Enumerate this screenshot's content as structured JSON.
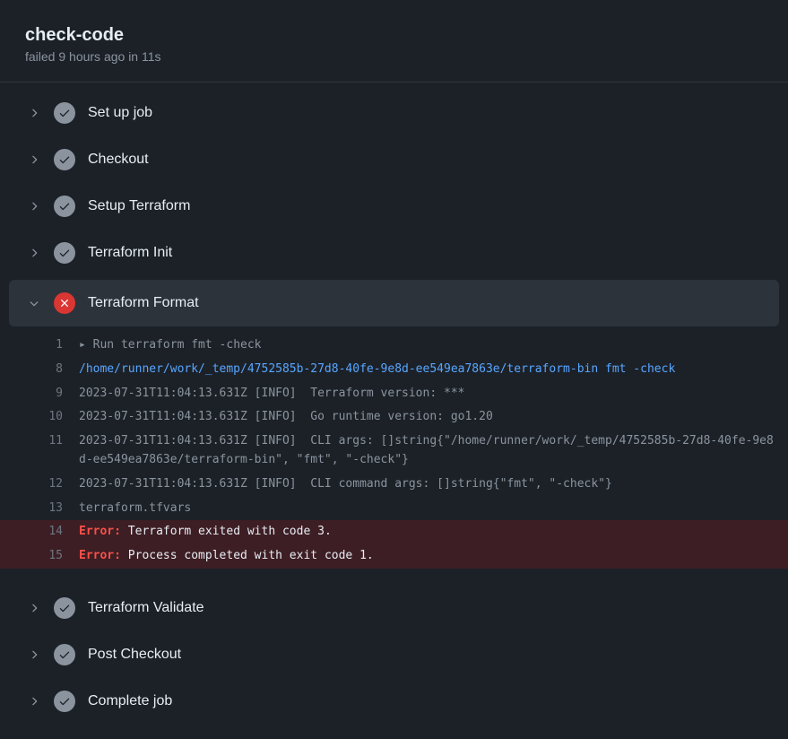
{
  "header": {
    "title": "check-code",
    "status": "failed 9 hours ago in 11s"
  },
  "steps": [
    {
      "name": "Set up job",
      "status": "success",
      "expanded": false
    },
    {
      "name": "Checkout",
      "status": "success",
      "expanded": false
    },
    {
      "name": "Setup Terraform",
      "status": "success",
      "expanded": false
    },
    {
      "name": "Terraform Init",
      "status": "success",
      "expanded": false
    },
    {
      "name": "Terraform Format",
      "status": "failed",
      "expanded": true
    },
    {
      "name": "Terraform Validate",
      "status": "success",
      "expanded": false
    },
    {
      "name": "Post Checkout",
      "status": "success",
      "expanded": false
    },
    {
      "name": "Complete job",
      "status": "success",
      "expanded": false
    }
  ],
  "log": {
    "lines": [
      {
        "num": "1",
        "type": "run",
        "prefix": "▸ ",
        "text": "Run terraform fmt -check"
      },
      {
        "num": "8",
        "type": "link",
        "text": "/home/runner/work/_temp/4752585b-27d8-40fe-9e8d-ee549ea7863e/terraform-bin fmt -check"
      },
      {
        "num": "9",
        "type": "normal",
        "text": "2023-07-31T11:04:13.631Z [INFO]  Terraform version: ***"
      },
      {
        "num": "10",
        "type": "normal",
        "text": "2023-07-31T11:04:13.631Z [INFO]  Go runtime version: go1.20"
      },
      {
        "num": "11",
        "type": "normal",
        "text": "2023-07-31T11:04:13.631Z [INFO]  CLI args: []string{\"/home/runner/work/_temp/4752585b-27d8-40fe-9e8d-ee549ea7863e/terraform-bin\", \"fmt\", \"-check\"}"
      },
      {
        "num": "12",
        "type": "normal",
        "text": "2023-07-31T11:04:13.631Z [INFO]  CLI command args: []string{\"fmt\", \"-check\"}"
      },
      {
        "num": "13",
        "type": "normal",
        "text": "terraform.tfvars"
      },
      {
        "num": "14",
        "type": "error",
        "label": "Error:",
        "text": " Terraform exited with code 3."
      },
      {
        "num": "15",
        "type": "error",
        "label": "Error:",
        "text": " Process completed with exit code 1."
      }
    ]
  }
}
